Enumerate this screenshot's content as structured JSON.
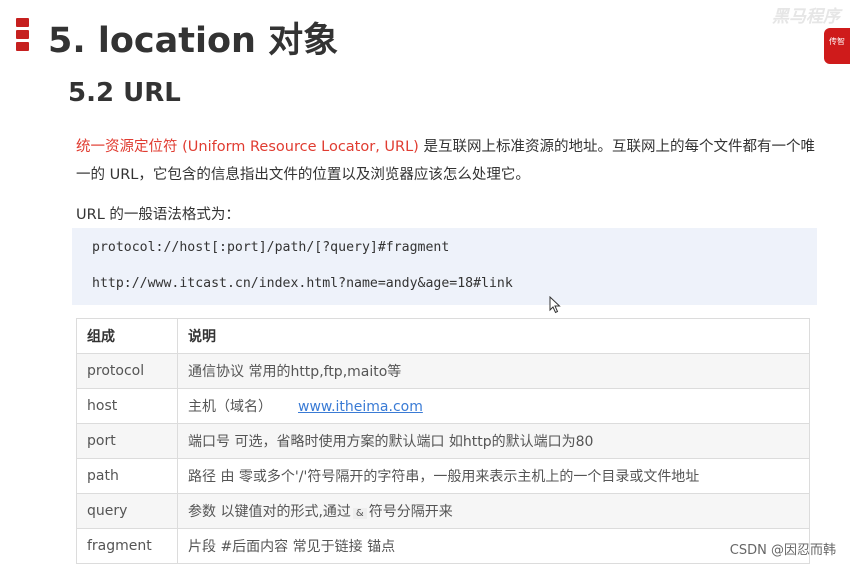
{
  "heading": {
    "title": "5. location 对象"
  },
  "logo": {
    "brand_text": "黑马程序",
    "badge_text": "传智"
  },
  "section": {
    "title": "5.2 URL"
  },
  "intro": {
    "highlight": "统一资源定位符 (Uniform Resource Locator, URL)",
    "rest": " 是互联网上标准资源的地址。互联网上的每个文件都有一个唯一的 URL，它包含的信息指出文件的位置以及浏览器应该怎么处理它。"
  },
  "syntax_label": "URL 的一般语法格式为：",
  "code": {
    "line1": "protocol://host[:port]/path/[?query]#fragment",
    "line2": "http://www.itcast.cn/index.html?name=andy&age=18#link"
  },
  "table": {
    "headers": [
      "组成",
      "说明"
    ],
    "rows": [
      {
        "name": "protocol",
        "desc": "通信协议 常用的http,ftp,maito等"
      },
      {
        "name": "host",
        "desc": "主机（域名）",
        "link": "www.itheima.com"
      },
      {
        "name": "port",
        "desc": "端口号 可选，省略时使用方案的默认端口 如http的默认端口为80"
      },
      {
        "name": "path",
        "desc": "路径 由 零或多个'/'符号隔开的字符串，一般用来表示主机上的一个目录或文件地址"
      },
      {
        "name": "query",
        "desc_pre": "参数  以键值对的形式,通过",
        "amp": "&",
        "desc_post": "符号分隔开来"
      },
      {
        "name": "fragment",
        "desc": "片段  #后面内容 常见于链接 锚点"
      }
    ]
  },
  "watermark": "CSDN @因忍而韩",
  "colors": {
    "accent_red": "#c6201f",
    "highlight_red": "#e03c31",
    "code_bg": "#eef2fa",
    "link_blue": "#3a7bd5"
  }
}
